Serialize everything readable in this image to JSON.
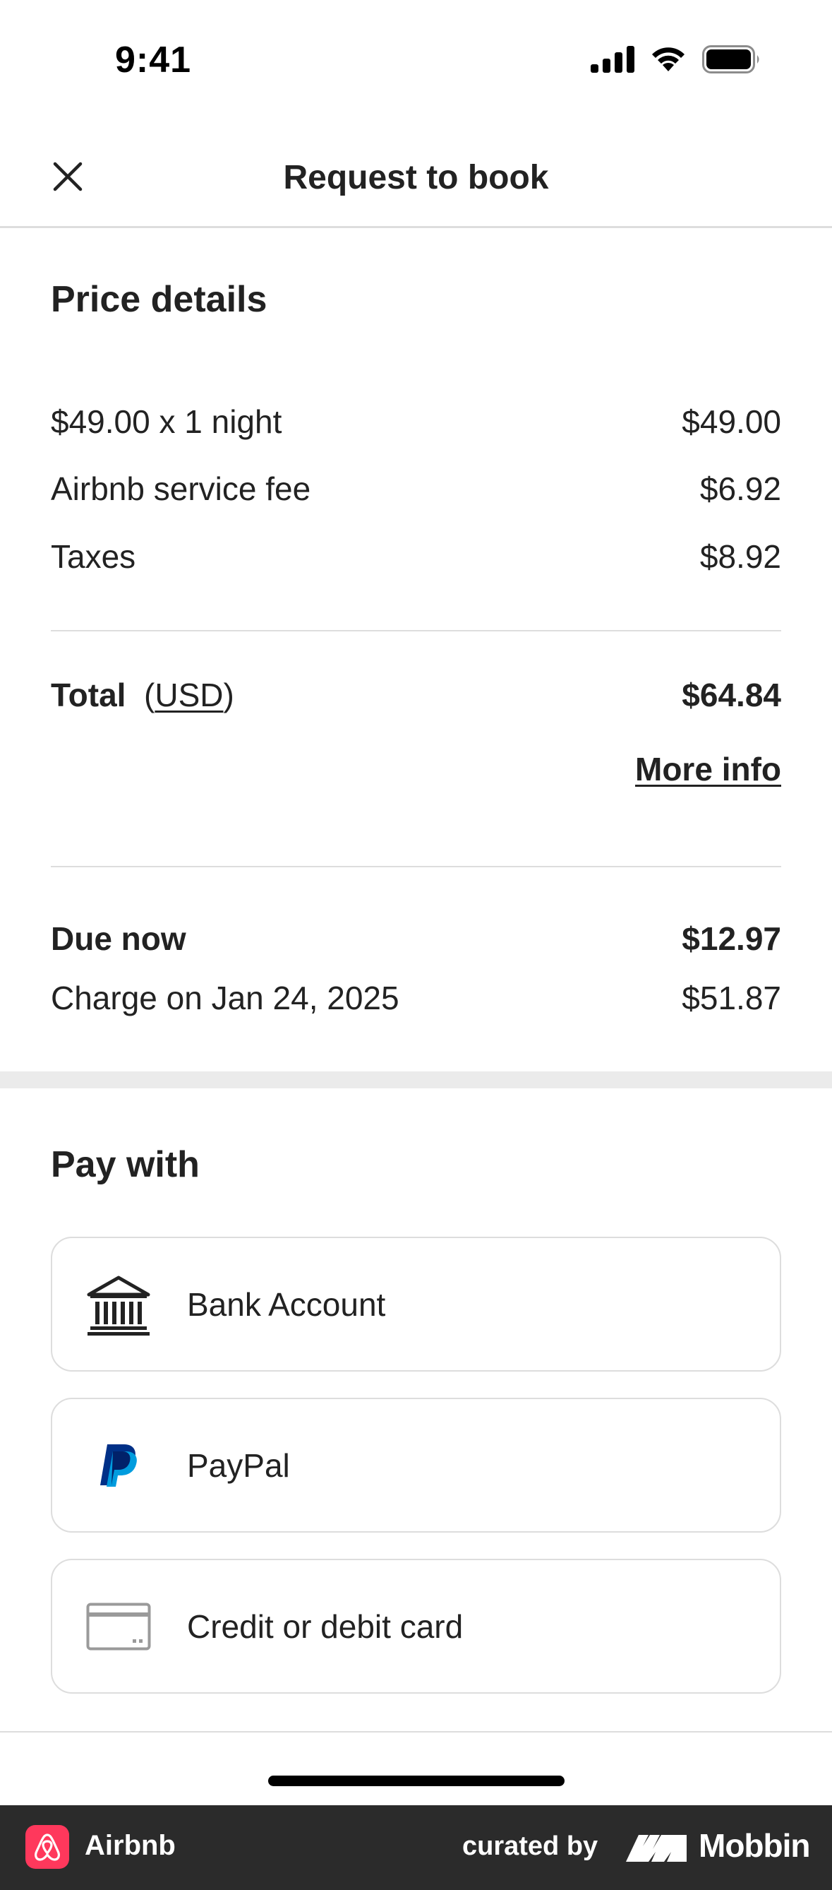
{
  "status_bar": {
    "time": "9:41"
  },
  "header": {
    "title": "Request to book"
  },
  "price_details": {
    "title": "Price details",
    "lines": [
      {
        "label": "$49.00 x 1 night",
        "value": "$49.00"
      },
      {
        "label": "Airbnb service fee",
        "value": "$6.92"
      },
      {
        "label": "Taxes",
        "value": "$8.92"
      }
    ],
    "total": {
      "label": "Total",
      "currency_open": "(",
      "currency": "USD",
      "currency_close": ")",
      "value": "$64.84"
    },
    "more_info": "More info",
    "due_now": {
      "label": "Due now",
      "value": "$12.97"
    },
    "charge_later": {
      "label": "Charge on Jan 24, 2025",
      "value": "$51.87"
    }
  },
  "pay_with": {
    "title": "Pay with",
    "options": [
      {
        "label": "Bank Account",
        "icon": "bank-icon"
      },
      {
        "label": "PayPal",
        "icon": "paypal-icon"
      },
      {
        "label": "Credit or debit card",
        "icon": "credit-card-icon"
      }
    ]
  },
  "footer": {
    "app_name": "Airbnb",
    "curated_by": "curated by",
    "brand": "Mobbin"
  },
  "colors": {
    "airbnb_brand": "#ff385c",
    "paypal_dark": "#003087",
    "paypal_light": "#009cde",
    "text": "#222222",
    "divider": "#dddddd"
  }
}
